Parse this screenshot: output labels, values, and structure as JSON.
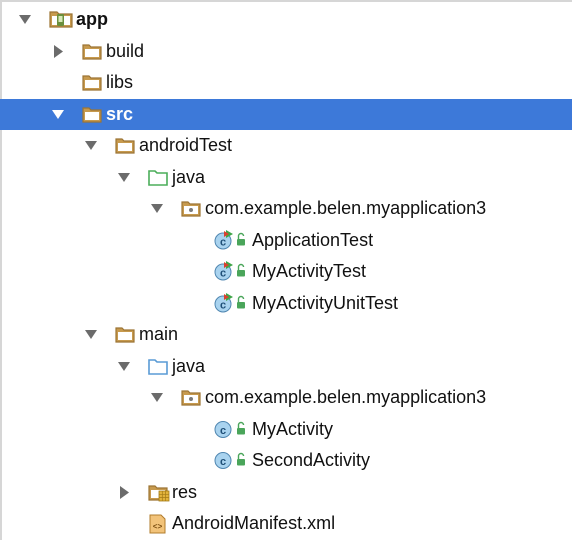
{
  "tree": {
    "nodes": [
      {
        "id": "app",
        "label": "app",
        "depth": 0,
        "expander": "expanded",
        "icon": "module-folder-icon",
        "selected": false,
        "bold": true
      },
      {
        "id": "build",
        "label": "build",
        "depth": 1,
        "expander": "collapsed",
        "icon": "folder-icon",
        "selected": false,
        "bold": false
      },
      {
        "id": "libs",
        "label": "libs",
        "depth": 1,
        "expander": "none",
        "icon": "folder-icon",
        "selected": false,
        "bold": false
      },
      {
        "id": "src",
        "label": "src",
        "depth": 1,
        "expander": "expanded",
        "icon": "folder-icon",
        "selected": true,
        "bold": true
      },
      {
        "id": "androidtest",
        "label": "androidTest",
        "depth": 2,
        "expander": "expanded",
        "icon": "folder-icon",
        "selected": false,
        "bold": false
      },
      {
        "id": "androidtest-java",
        "label": "java",
        "depth": 3,
        "expander": "expanded",
        "icon": "test-source-folder-icon",
        "selected": false,
        "bold": false
      },
      {
        "id": "androidtest-package",
        "label": "com.example.belen.myapplication3",
        "depth": 4,
        "expander": "expanded",
        "icon": "package-icon",
        "selected": false,
        "bold": false
      },
      {
        "id": "applicationtest",
        "label": "ApplicationTest",
        "depth": 5,
        "expander": "none",
        "icon": "test-class-icon",
        "selected": false,
        "bold": false
      },
      {
        "id": "myactivitytest",
        "label": "MyActivityTest",
        "depth": 5,
        "expander": "none",
        "icon": "test-class-icon",
        "selected": false,
        "bold": false
      },
      {
        "id": "myactivityunittest",
        "label": "MyActivityUnitTest",
        "depth": 5,
        "expander": "none",
        "icon": "test-class-icon",
        "selected": false,
        "bold": false
      },
      {
        "id": "main",
        "label": "main",
        "depth": 2,
        "expander": "expanded",
        "icon": "folder-icon",
        "selected": false,
        "bold": false
      },
      {
        "id": "main-java",
        "label": "java",
        "depth": 3,
        "expander": "expanded",
        "icon": "source-folder-icon",
        "selected": false,
        "bold": false
      },
      {
        "id": "main-package",
        "label": "com.example.belen.myapplication3",
        "depth": 4,
        "expander": "expanded",
        "icon": "package-icon",
        "selected": false,
        "bold": false
      },
      {
        "id": "myactivity",
        "label": "MyActivity",
        "depth": 5,
        "expander": "none",
        "icon": "class-icon",
        "selected": false,
        "bold": false
      },
      {
        "id": "secondactivity",
        "label": "SecondActivity",
        "depth": 5,
        "expander": "none",
        "icon": "class-icon",
        "selected": false,
        "bold": false
      },
      {
        "id": "res",
        "label": "res",
        "depth": 3,
        "expander": "collapsed",
        "icon": "resource-folder-icon",
        "selected": false,
        "bold": false
      },
      {
        "id": "androidmanifest",
        "label": "AndroidManifest.xml",
        "depth": 3,
        "expander": "none",
        "icon": "xml-file-icon",
        "selected": false,
        "bold": false
      }
    ]
  },
  "colors": {
    "selection": "#3d79d9",
    "folder": "#c79a4e",
    "test_folder": "#4bad5a",
    "source_folder": "#5a9bd5",
    "class_circle": "#a9d3ef",
    "lock": "#4aa55a",
    "arrow": "#6b6b6b"
  }
}
